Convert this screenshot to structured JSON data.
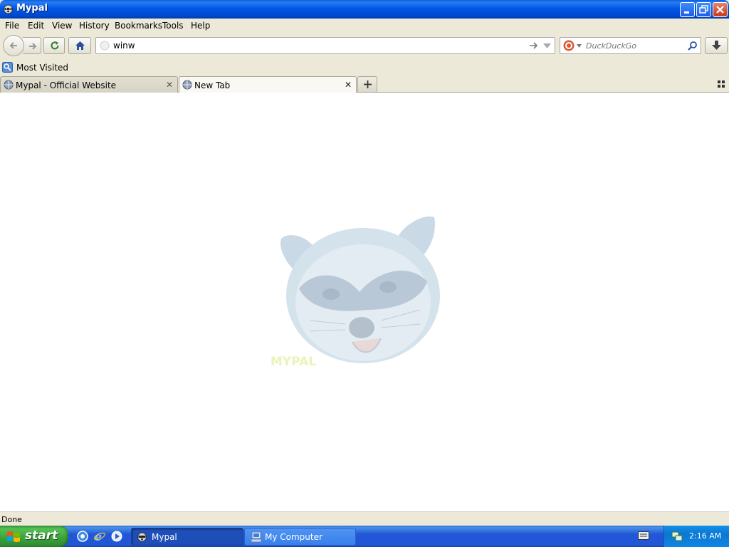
{
  "window": {
    "title": "Mypal",
    "app_icon": "raccoon-icon",
    "controls": [
      "minimize-icon",
      "restore-icon",
      "close-icon"
    ]
  },
  "menu": {
    "items": [
      "File",
      "Edit",
      "View",
      "History",
      "Bookmarks",
      "Tools",
      "Help"
    ]
  },
  "navbar": {
    "url_value": "winw",
    "search_placeholder": "DuckDuckGo",
    "icons": [
      "back-arrow-icon",
      "forward-arrow-icon",
      "reload-icon",
      "home-icon",
      "go-arrow-icon",
      "dropdown-icon",
      "duckduckgo-icon",
      "search-icon",
      "download-icon"
    ]
  },
  "bookmarks": {
    "items": [
      "Most Visited"
    ]
  },
  "tabs": [
    {
      "label": "Mypal - Official Website",
      "active": false
    },
    {
      "label": "New Tab",
      "active": true
    }
  ],
  "content": {
    "logo": "raccoon-face-logo",
    "logo_text": "MYPAL"
  },
  "status": {
    "text": "Done"
  },
  "taskbar": {
    "start_label": "start",
    "quick_launch": [
      "ie-icon",
      "browser-icon",
      "media-player-icon"
    ],
    "buttons": [
      {
        "label": "Mypal",
        "active": true
      },
      {
        "label": "My Computer",
        "active": false
      }
    ],
    "clock": "2:16 AM"
  },
  "colors": {
    "titlebar": "#0058e6",
    "taskbar": "#2157d7",
    "start": "#3aa13a",
    "chrome": "#ece9d8"
  }
}
